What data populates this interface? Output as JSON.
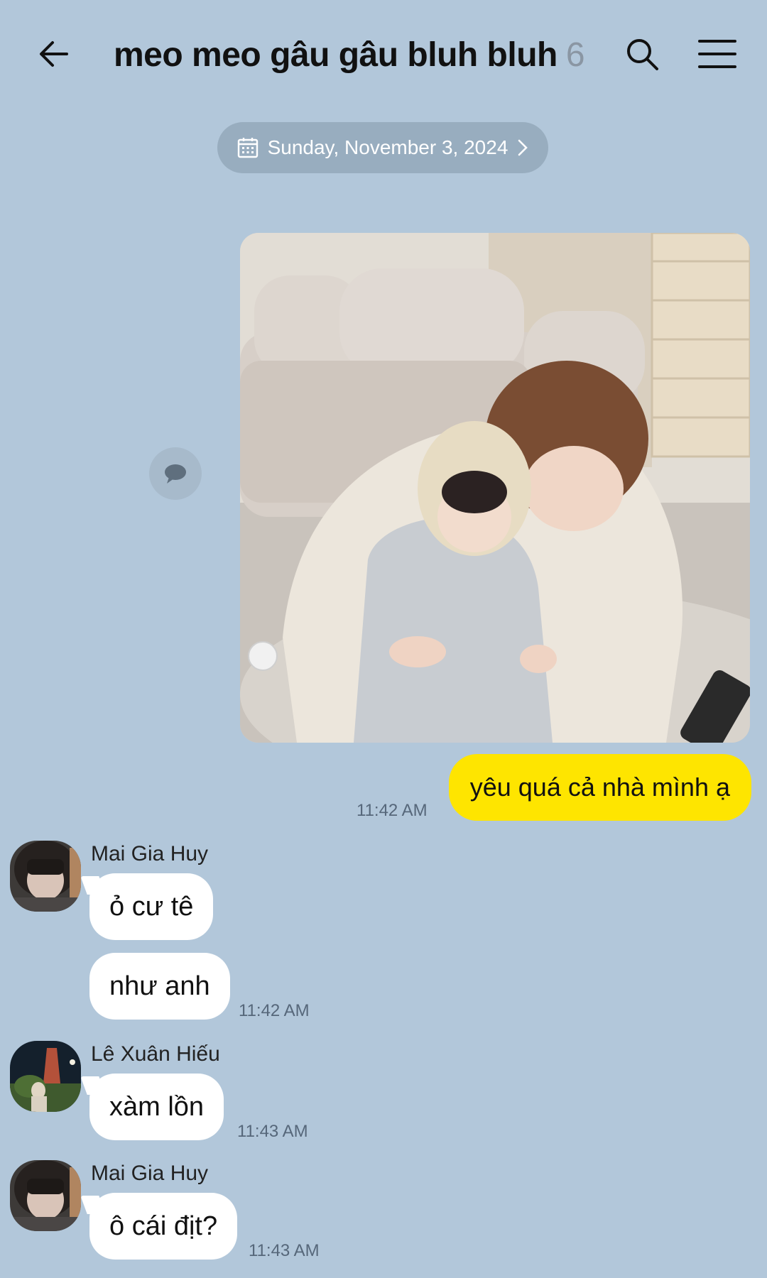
{
  "header": {
    "title": "meo meo gâu gâu bluh bluh",
    "member_count": "6",
    "back_icon": "back-arrow-icon",
    "search_icon": "search-icon",
    "menu_icon": "hamburger-menu-icon"
  },
  "date_divider": {
    "label": "Sunday, November 3, 2024",
    "icon": "calendar-icon"
  },
  "messages": [
    {
      "type": "photo",
      "from": "me",
      "share_icon": "speech-bubble-icon"
    },
    {
      "type": "text",
      "from": "me",
      "text": "yêu quá cả nhà mình ạ",
      "time": "11:42 AM"
    },
    {
      "type": "text",
      "from": "Mai Gia Huy",
      "sender": "Mai Gia Huy",
      "text": "ỏ cư tê"
    },
    {
      "type": "text",
      "from": "Mai Gia Huy",
      "text": "như anh",
      "time": "11:42 AM"
    },
    {
      "type": "text",
      "from": "Lê Xuân Hiếu",
      "sender": "Lê Xuân Hiếu",
      "text": "xàm lồn",
      "time": "11:43 AM"
    },
    {
      "type": "text",
      "from": "Mai Gia Huy",
      "sender": "Mai Gia Huy",
      "text": "ô cái địt?",
      "time": "11:43 AM"
    }
  ],
  "colors": {
    "background": "#b2c7da",
    "my_bubble": "#fee500",
    "their_bubble": "#ffffff"
  }
}
